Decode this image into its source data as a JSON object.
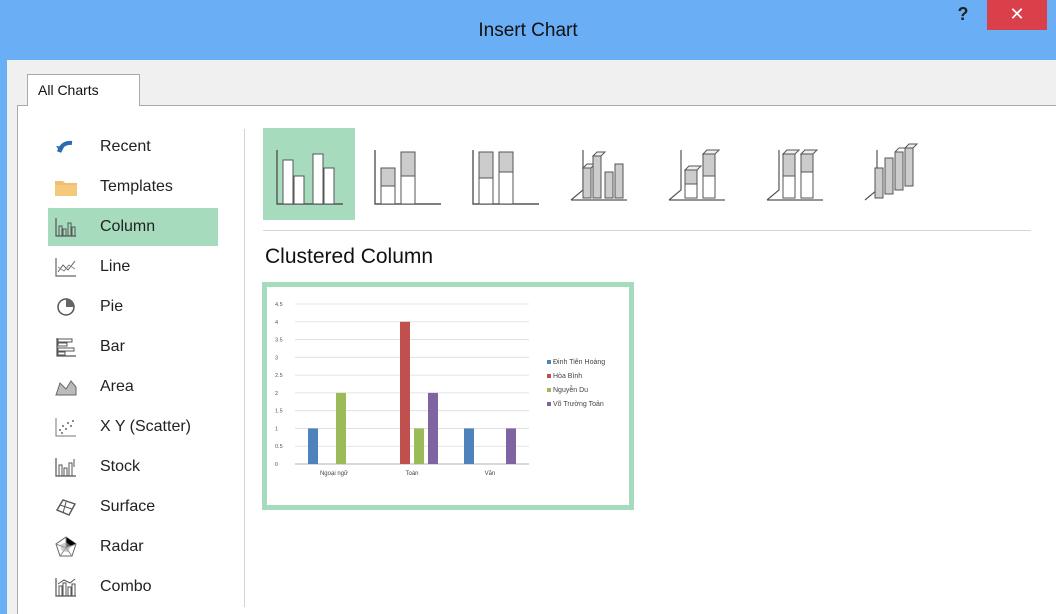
{
  "window": {
    "title": "Insert Chart",
    "help_label": "?",
    "close_label": "✕"
  },
  "tabs": [
    {
      "label": "All Charts"
    }
  ],
  "sidebar": {
    "items": [
      {
        "label": "Recent",
        "icon": "recent-icon"
      },
      {
        "label": "Templates",
        "icon": "folder-icon"
      },
      {
        "label": "Column",
        "icon": "column-chart-icon",
        "selected": true
      },
      {
        "label": "Line",
        "icon": "line-chart-icon"
      },
      {
        "label": "Pie",
        "icon": "pie-chart-icon"
      },
      {
        "label": "Bar",
        "icon": "bar-chart-icon"
      },
      {
        "label": "Area",
        "icon": "area-chart-icon"
      },
      {
        "label": "X Y (Scatter)",
        "icon": "scatter-chart-icon"
      },
      {
        "label": "Stock",
        "icon": "stock-chart-icon"
      },
      {
        "label": "Surface",
        "icon": "surface-chart-icon"
      },
      {
        "label": "Radar",
        "icon": "radar-chart-icon"
      },
      {
        "label": "Combo",
        "icon": "combo-chart-icon"
      }
    ]
  },
  "subtypes": [
    {
      "name": "clustered-column",
      "selected": true
    },
    {
      "name": "stacked-column"
    },
    {
      "name": "100-stacked-column"
    },
    {
      "name": "3d-clustered-column"
    },
    {
      "name": "3d-stacked-column"
    },
    {
      "name": "3d-100-stacked-column"
    },
    {
      "name": "3d-column"
    }
  ],
  "preview": {
    "title": "Clustered Column",
    "chart_data": {
      "type": "bar",
      "categories": [
        "Ngoại ngữ",
        "Toán",
        "Văn"
      ],
      "series": [
        {
          "name": "Đinh Tiên Hoàng",
          "values": [
            1,
            0,
            1
          ],
          "color": "#4f81bd"
        },
        {
          "name": "Hòa Bình",
          "values": [
            0,
            4,
            0
          ],
          "color": "#c0504d"
        },
        {
          "name": "Nguyễn Du",
          "values": [
            2,
            1,
            0
          ],
          "color": "#9bbb59"
        },
        {
          "name": "Võ Trường Toản",
          "values": [
            0,
            2,
            1
          ],
          "color": "#8064a2"
        }
      ],
      "ylim": [
        0,
        4.5
      ],
      "yticks": [
        "0",
        "0.5",
        "1",
        "1.5",
        "2",
        "2.5",
        "3",
        "3.5",
        "4",
        "4.5"
      ],
      "grid": true,
      "legend_position": "right"
    }
  },
  "colors": {
    "titlebar": "#6aaef5",
    "selection": "#a7dbbd",
    "close": "#d9404a"
  }
}
